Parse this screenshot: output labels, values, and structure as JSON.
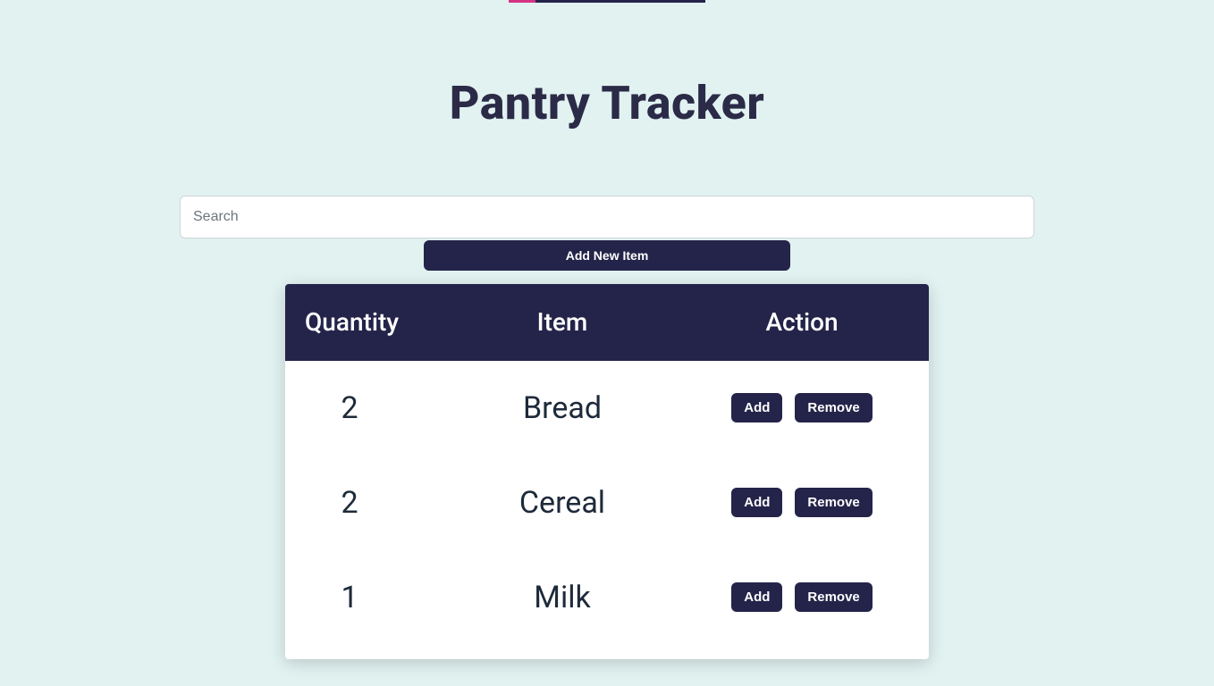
{
  "page": {
    "title": "Pantry Tracker"
  },
  "search": {
    "placeholder": "Search",
    "value": ""
  },
  "buttons": {
    "add_new_label": "Add New Item",
    "row_add_label": "Add",
    "row_remove_label": "Remove"
  },
  "table": {
    "headers": {
      "quantity": "Quantity",
      "item": "Item",
      "action": "Action"
    },
    "rows": [
      {
        "quantity": "2",
        "item": "Bread"
      },
      {
        "quantity": "2",
        "item": "Cereal"
      },
      {
        "quantity": "1",
        "item": "Milk"
      }
    ]
  },
  "colors": {
    "background": "#e1f2f1",
    "navy": "#24244a",
    "accent_pink": "#d63384"
  }
}
